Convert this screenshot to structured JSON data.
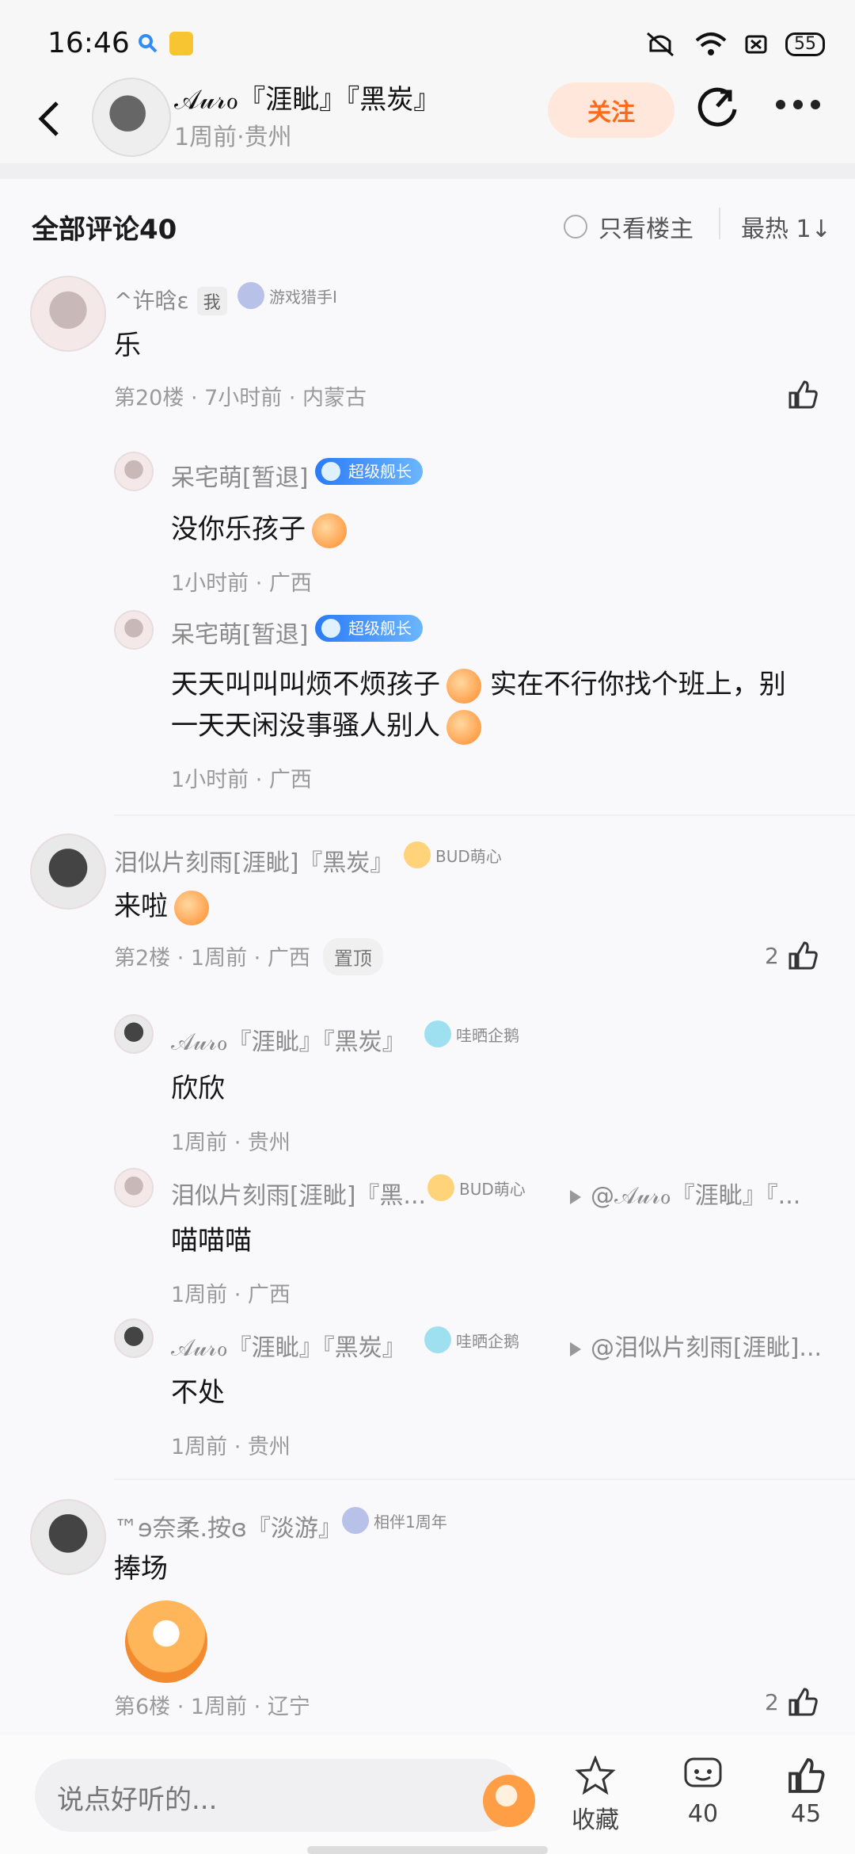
{
  "status_bar": {
    "time": "16:46",
    "battery": "55"
  },
  "header": {
    "author": "𝒜𝓊𝓇ℴ『涯眦』『黑炭』",
    "subtitle": "1周前·贵州",
    "follow_label": "关注"
  },
  "comments_header": {
    "title": "全部评论40",
    "only_op": "只看楼主",
    "sort": "最热 1↓"
  },
  "comments": [
    {
      "user": "^许晗ε",
      "me_tag": "我",
      "badge": "游戏猎手I",
      "text": "乐",
      "meta": "第20楼 · 7小时前 · 内蒙古",
      "replies": [
        {
          "user": "呆宅萌[暂退]",
          "badge": "超级舰长",
          "text": "没你乐孩子",
          "meta": "1小时前 · 广西"
        },
        {
          "user": "呆宅萌[暂退]",
          "badge": "超级舰长",
          "text_line1": "天天叫叫叫烦不烦孩子",
          "text_line1b": "实在不行你找个班上，别",
          "text_line2": "一天天闲没事骚人别人",
          "meta": "1小时前 · 广西"
        }
      ]
    },
    {
      "user": "泪似片刻雨[涯眦]『黑炭』",
      "badge": "BUD萌心",
      "text": "来啦",
      "meta": "第2楼 · 1周前 · 广西",
      "pin": "置顶",
      "likes": "2",
      "replies": [
        {
          "user": "𝒜𝓊𝓇ℴ『涯眦』『黑炭』",
          "badge": "哇晒企鹅",
          "text": "欣欣",
          "meta": "1周前 · 贵州"
        },
        {
          "user": "泪似片刻雨[涯眦]『黑...",
          "badge": "BUD萌心",
          "reply_to": "@𝒜𝓊𝓇ℴ『涯眦』『...",
          "text": "喵喵喵",
          "meta": "1周前 · 广西"
        },
        {
          "user": "𝒜𝓊𝓇ℴ『涯眦』『黑炭』",
          "badge": "哇晒企鹅",
          "reply_to": "@泪似片刻雨[涯眦]...",
          "text": "不处",
          "meta": "1周前 · 贵州"
        }
      ]
    },
    {
      "user": "™ɘ奈柔.按ɞ『淡游』",
      "badge": "相伴1周年",
      "text": "捧场",
      "meta": "第6楼 · 1周前 · 辽宁",
      "likes": "2"
    }
  ],
  "bottom_bar": {
    "input_placeholder": "说点好听的...",
    "favorite_label": "收藏",
    "comment_count": "40",
    "like_count": "45"
  },
  "colors": {
    "accent": "#ff6a1a",
    "follow_bg": "#ffe7dc",
    "badge_blue": "#2a7bf6"
  }
}
